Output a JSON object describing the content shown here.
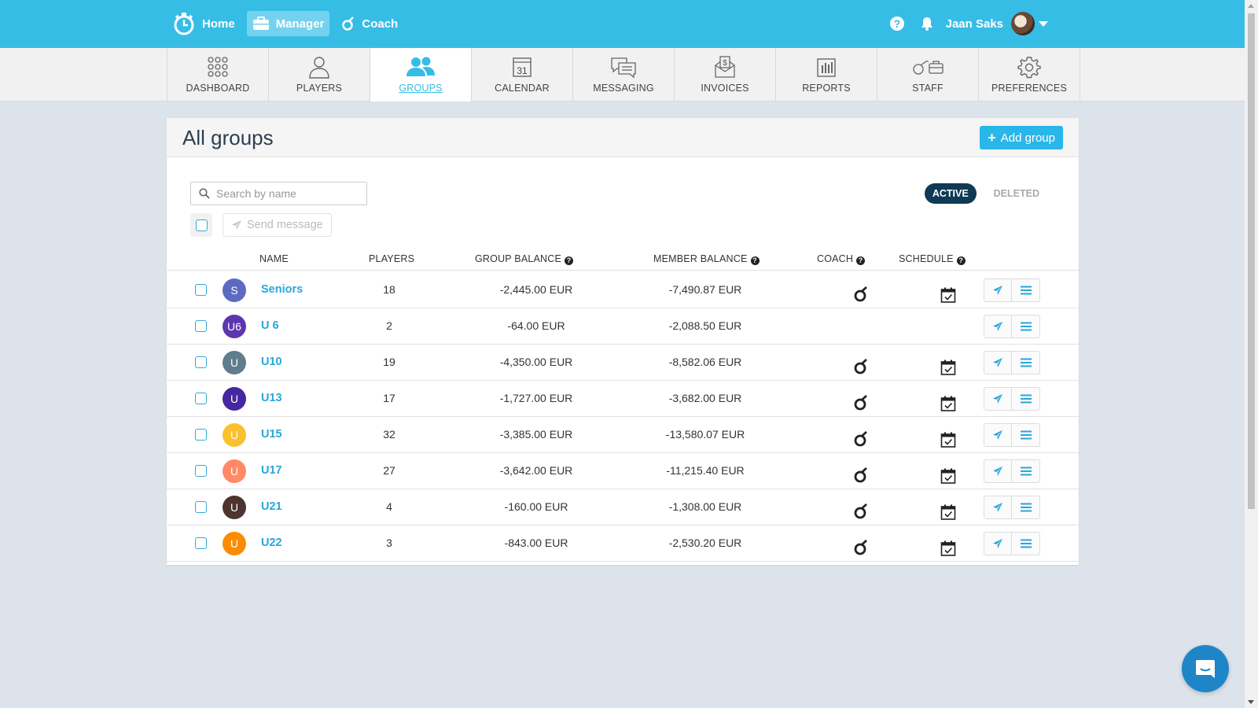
{
  "topbar": {
    "home_label": "Home",
    "manager_label": "Manager",
    "coach_label": "Coach",
    "user_name": "Jaan Saks",
    "bg_color": "#36bde6"
  },
  "modules": [
    {
      "label": "DASHBOARD",
      "icon": "grid-icon"
    },
    {
      "label": "PLAYERS",
      "icon": "person-icon"
    },
    {
      "label": "GROUPS",
      "icon": "group-icon",
      "active": true
    },
    {
      "label": "CALENDAR",
      "icon": "calendar-icon",
      "day": "31"
    },
    {
      "label": "MESSAGING",
      "icon": "chat-bubbles-icon"
    },
    {
      "label": "INVOICES",
      "icon": "invoice-icon"
    },
    {
      "label": "REPORTS",
      "icon": "bar-chart-icon"
    },
    {
      "label": "STAFF",
      "icon": "staff-icon"
    },
    {
      "label": "PREFERENCES",
      "icon": "gear-icon"
    }
  ],
  "panel": {
    "title": "All groups",
    "add_button": "Add group",
    "search_placeholder": "Search by name",
    "send_message": "Send message",
    "filter_active": "ACTIVE",
    "filter_deleted": "DELETED"
  },
  "table": {
    "headers": {
      "name": "NAME",
      "players": "PLAYERS",
      "group_balance": "GROUP BALANCE",
      "member_balance": "MEMBER BALANCE",
      "coach": "COACH",
      "schedule": "SCHEDULE"
    },
    "rows": [
      {
        "initial": "S",
        "color": "#5c6bc0",
        "name": "Seniors",
        "players": "18",
        "group_balance": "-2,445.00 EUR",
        "member_balance": "-7,490.87 EUR",
        "coach": true,
        "schedule": true
      },
      {
        "initial": "U6",
        "color": "#5e35b1",
        "name": "U 6",
        "players": "2",
        "group_balance": "-64.00 EUR",
        "member_balance": "-2,088.50 EUR",
        "coach": false,
        "schedule": false
      },
      {
        "initial": "U",
        "color": "#607d8b",
        "name": "U10",
        "players": "19",
        "group_balance": "-4,350.00 EUR",
        "member_balance": "-8,582.06 EUR",
        "coach": true,
        "schedule": true
      },
      {
        "initial": "U",
        "color": "#4527a0",
        "name": "U13",
        "players": "17",
        "group_balance": "-1,727.00 EUR",
        "member_balance": "-3,682.00 EUR",
        "coach": true,
        "schedule": true
      },
      {
        "initial": "U",
        "color": "#fbc02d",
        "name": "U15",
        "players": "32",
        "group_balance": "-3,385.00 EUR",
        "member_balance": "-13,580.07 EUR",
        "coach": true,
        "schedule": true
      },
      {
        "initial": "U",
        "color": "#ff8a65",
        "name": "U17",
        "players": "27",
        "group_balance": "-3,642.00 EUR",
        "member_balance": "-11,215.40 EUR",
        "coach": true,
        "schedule": true
      },
      {
        "initial": "U",
        "color": "#4e342e",
        "name": "U21",
        "players": "4",
        "group_balance": "-160.00 EUR",
        "member_balance": "-1,308.00 EUR",
        "coach": true,
        "schedule": true
      },
      {
        "initial": "U",
        "color": "#fb8c00",
        "name": "U22",
        "players": "3",
        "group_balance": "-843.00 EUR",
        "member_balance": "-2,530.20 EUR",
        "coach": true,
        "schedule": true
      }
    ]
  }
}
